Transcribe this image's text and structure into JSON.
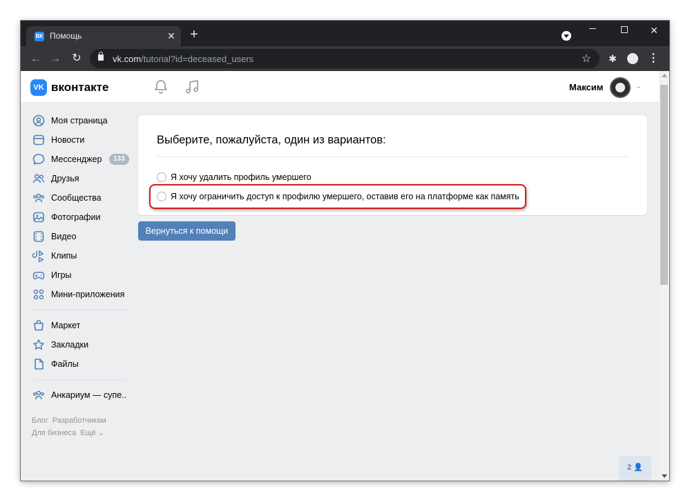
{
  "browser": {
    "tab_title": "Помощь",
    "tab_favicon": "ВК",
    "tab_close": "✕",
    "new_tab": "+",
    "url_host": "vk.com",
    "url_path": "/tutorial?id=deceased_users",
    "icons": [
      "back-arrow-icon",
      "forward-arrow-icon",
      "reload-icon",
      "lock-icon",
      "star-icon",
      "puzzle-icon",
      "menu-dots-icon"
    ]
  },
  "header": {
    "brand": "вконтакте",
    "logo_text": "VK",
    "user_name": "Максим",
    "accent": "#2787f5"
  },
  "sidebar": {
    "items": [
      {
        "label": "Моя страница",
        "icon": "user-circle-icon"
      },
      {
        "label": "Новости",
        "icon": "news-icon"
      },
      {
        "label": "Мессенджер",
        "icon": "message-icon",
        "badge": "133"
      },
      {
        "label": "Друзья",
        "icon": "friends-icon"
      },
      {
        "label": "Сообщества",
        "icon": "communities-icon"
      },
      {
        "label": "Фотографии",
        "icon": "photo-icon"
      },
      {
        "label": "Видео",
        "icon": "video-icon"
      },
      {
        "label": "Клипы",
        "icon": "clips-icon"
      },
      {
        "label": "Игры",
        "icon": "games-icon"
      },
      {
        "label": "Мини-приложения",
        "icon": "mini-apps-icon"
      }
    ],
    "items2": [
      {
        "label": "Маркет",
        "icon": "market-icon"
      },
      {
        "label": "Закладки",
        "icon": "bookmark-icon"
      },
      {
        "label": "Файлы",
        "icon": "files-icon"
      }
    ],
    "items3": [
      {
        "label": "Анкариум — супе..",
        "icon": "community-icon"
      }
    ],
    "footer": {
      "blog": "Блог",
      "devs": "Разработчикам",
      "business": "Для бизнеса",
      "more": "Ещё ⌄"
    }
  },
  "main": {
    "title": "Выберите, пожалуйста, один из вариантов:",
    "options": [
      "Я хочу удалить профиль умершего",
      "Я хочу ограничить доступ к профилю умершего, оставив его на платформе как память"
    ],
    "back_button": "Вернуться к помощи",
    "highlight_color": "#d11a1a"
  },
  "widget": {
    "label": "2 👤"
  }
}
